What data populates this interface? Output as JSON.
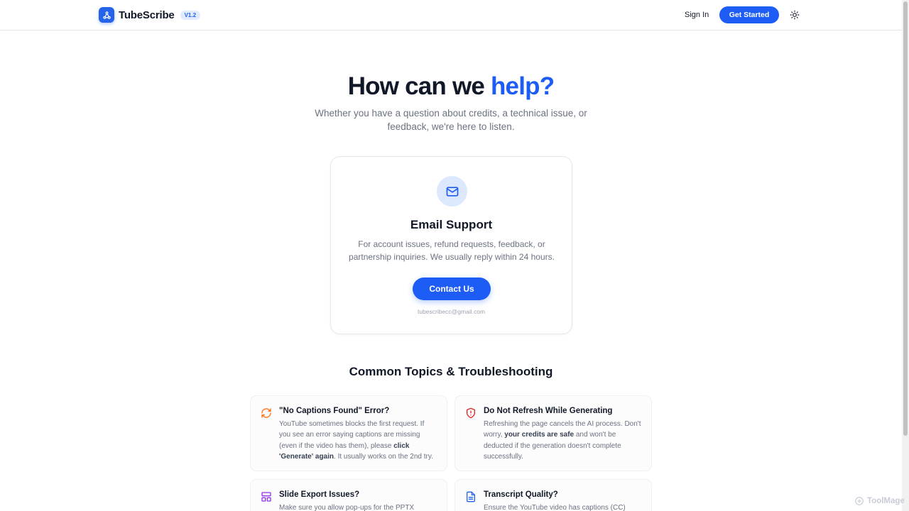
{
  "header": {
    "logo_text": "TubeScribe",
    "version": "V1.2",
    "sign_in": "Sign In",
    "get_started": "Get Started"
  },
  "hero": {
    "title_main": "How can we ",
    "title_accent": "help?",
    "subtitle": "Whether you have a question about credits, a technical issue, or feedback, we're here to listen."
  },
  "support": {
    "title": "Email Support",
    "description": "For account issues, refund requests, feedback, or partnership inquiries. We usually reply within 24 hours.",
    "button": "Contact Us",
    "email": "tubescribecc@gmail.com"
  },
  "topics": {
    "heading": "Common Topics & Troubleshooting",
    "items": [
      {
        "icon": "refresh-icon",
        "color": "#f97316",
        "title": "\"No Captions Found\" Error?",
        "body_1": "YouTube sometimes blocks the first request. If you see an error saying captions are missing (even if the video has them), please ",
        "body_bold": "click 'Generate' again",
        "body_2": ". It usually works on the 2nd try."
      },
      {
        "icon": "shield-alert-icon",
        "color": "#dc2626",
        "title": "Do Not Refresh While Generating",
        "body_1": "Refreshing the page cancels the AI process. Don't worry, ",
        "body_bold": "your credits are safe",
        "body_2": " and won't be deducted if the generation doesn't complete successfully."
      },
      {
        "icon": "layout-icon",
        "color": "#9333ea",
        "title": "Slide Export Issues?",
        "body_1": "Make sure you allow pop-ups for the PPTX",
        "body_bold": "",
        "body_2": ""
      },
      {
        "icon": "document-icon",
        "color": "#2563eb",
        "title": "Transcript Quality?",
        "body_1": "Ensure the YouTube video has captions (CC)",
        "body_bold": "",
        "body_2": ""
      }
    ]
  },
  "watermark": "ToolMage",
  "colors": {
    "accent": "#1d5cf5",
    "text": "#111827",
    "muted": "#6b7280"
  }
}
